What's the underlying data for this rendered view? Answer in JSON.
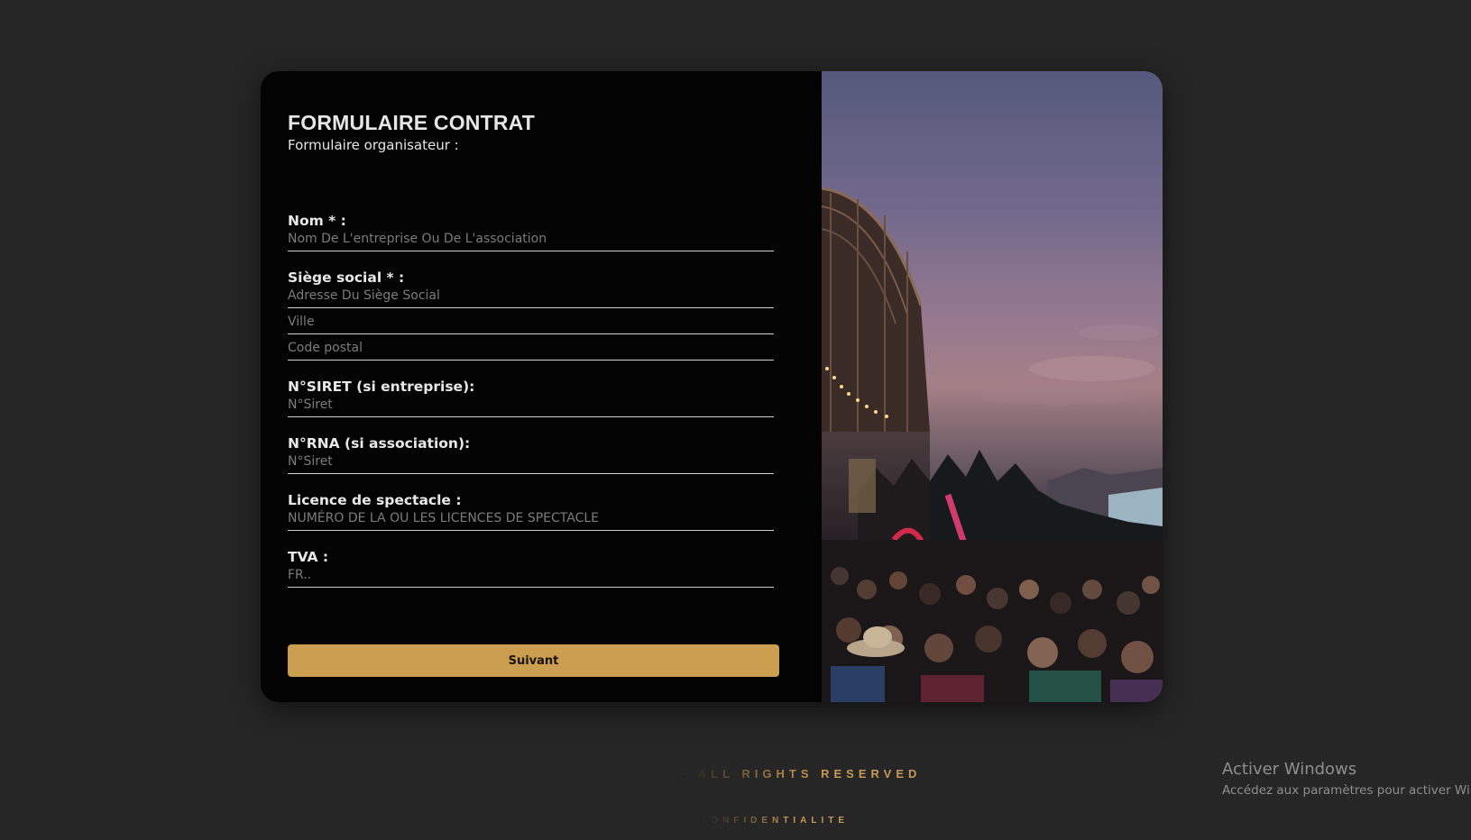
{
  "form": {
    "title": "FORMULAIRE CONTRAT",
    "subtitle": "Formulaire organisateur :",
    "fields": {
      "nom": {
        "label": "Nom * :",
        "placeholder": "Nom De L'entreprise Ou De L'association"
      },
      "siege": {
        "label": "Siège social * :",
        "address_placeholder": "Adresse Du Siège Social",
        "city_placeholder": "Ville",
        "postal_placeholder": "Code postal"
      },
      "siret": {
        "label": "N°SIRET (si entreprise):",
        "placeholder": "N°Siret"
      },
      "rna": {
        "label": "N°RNA (si association):",
        "placeholder": "N°Siret"
      },
      "licence": {
        "label": "Licence de spectacle :",
        "placeholder": "NUMÉRO DE LA OU LES LICENCES DE SPECTACLE"
      },
      "tva": {
        "label": "TVA :",
        "placeholder": "FR.."
      }
    },
    "submit_label": "Suivant"
  },
  "footer": {
    "rights": ". ALL RIGHTS RESERVED",
    "confidentiality": "CONFIDENTIALITÉ"
  },
  "os_watermark": {
    "title": "Activer Windows",
    "subtitle": "Accédez aux paramètres pour activer Windows."
  },
  "colors": {
    "page_background": "#262626",
    "card_background": "#030303",
    "accent": "#cc9f50"
  }
}
